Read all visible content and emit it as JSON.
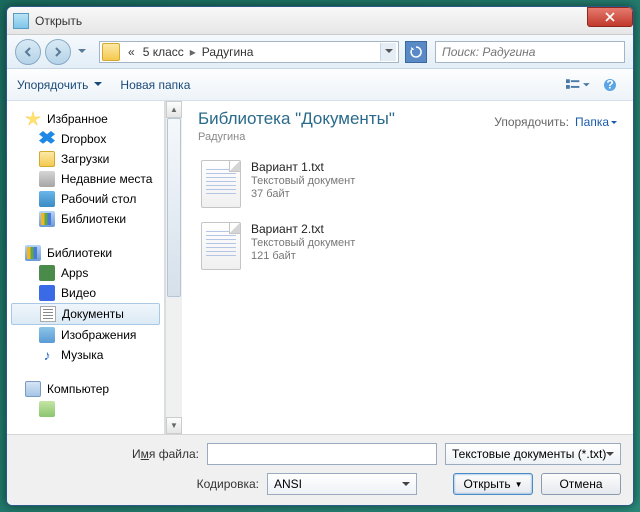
{
  "window": {
    "title": "Открыть"
  },
  "breadcrumb": {
    "chevrons": "«",
    "seg1": "5 класс",
    "seg2": "Радугина"
  },
  "search": {
    "placeholder": "Поиск: Радугина"
  },
  "toolbar": {
    "organize": "Упорядочить",
    "newfolder": "Новая папка"
  },
  "sidebar": {
    "favorites": {
      "label": "Избранное",
      "items": [
        {
          "label": "Dropbox"
        },
        {
          "label": "Загрузки"
        },
        {
          "label": "Недавние места"
        },
        {
          "label": "Рабочий стол"
        },
        {
          "label": "Библиотеки"
        }
      ]
    },
    "libraries": {
      "label": "Библиотеки",
      "items": [
        {
          "label": "Apps"
        },
        {
          "label": "Видео"
        },
        {
          "label": "Документы"
        },
        {
          "label": "Изображения"
        },
        {
          "label": "Музыка"
        }
      ]
    },
    "computer": {
      "label": "Компьютер"
    }
  },
  "content": {
    "library_title": "Библиотека \"Документы\"",
    "library_sub": "Радугина",
    "arrange_label": "Упорядочить:",
    "arrange_value": "Папка",
    "files": [
      {
        "name": "Вариант 1.txt",
        "type": "Текстовый документ",
        "size": "37 байт"
      },
      {
        "name": "Вариант 2.txt",
        "type": "Текстовый документ",
        "size": "121 байт"
      }
    ]
  },
  "footer": {
    "filename_label_pre": "И",
    "filename_label_u": "м",
    "filename_label_post": "я файла:",
    "filename_value": "",
    "filetype": "Текстовые документы (*.txt)",
    "encoding_label_pre": "Ко",
    "encoding_label_u": "д",
    "encoding_label_post": "ировка:",
    "encoding_value": "ANSI",
    "open": "Открыть",
    "cancel": "Отмена"
  }
}
